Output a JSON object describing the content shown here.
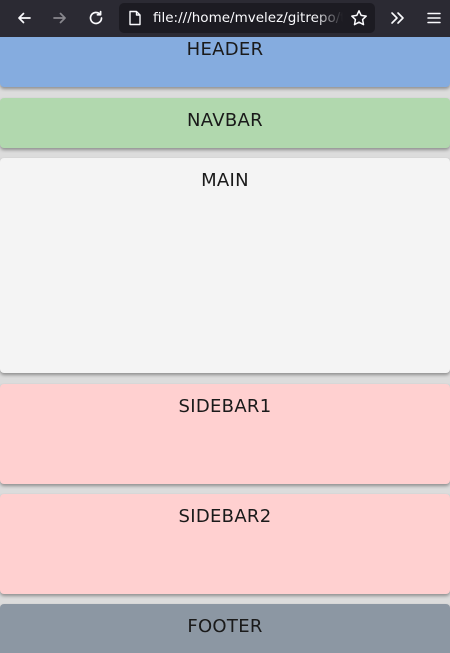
{
  "browser": {
    "url": "file:///home/mvelez/gitrepo/ta",
    "icons": {
      "back": "back-arrow-icon",
      "forward": "forward-arrow-icon",
      "reload": "reload-icon",
      "page": "page-icon",
      "bookmark": "star-icon",
      "overflow": "chevrons-right-icon",
      "menu": "hamburger-menu-icon"
    },
    "colors": {
      "toolbar": "#2b2a33",
      "urlbar": "#1c1b22",
      "icon": "#fbfbfe"
    }
  },
  "layout_blocks": {
    "header": "HEADER",
    "navbar": "NAVBAR",
    "main": "MAIN",
    "sidebar1": "SIDEBAR1",
    "sidebar2": "SIDEBAR2",
    "footer": "FOOTER"
  },
  "colors": {
    "header": "#85acdf",
    "navbar": "#b1d8ae",
    "main": "#f4f4f4",
    "sidebar": "#ffd0d0",
    "footer": "#8c97a3",
    "page_background": "#dcdcdc"
  }
}
